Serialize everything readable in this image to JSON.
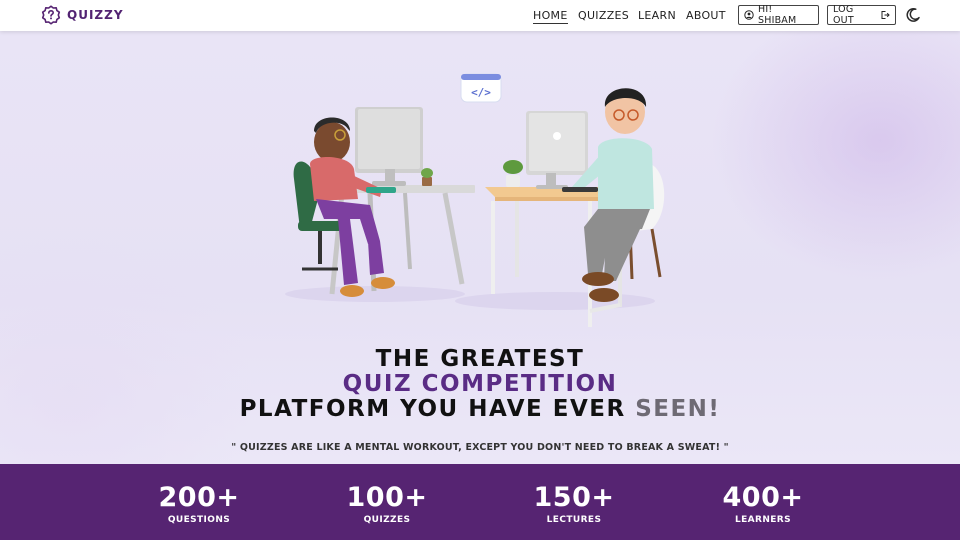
{
  "brand": {
    "name": "QUIZZY",
    "accent": "#562472"
  },
  "nav": {
    "links": [
      {
        "label": "HOME",
        "active": true
      },
      {
        "label": "QUIZZES",
        "active": false
      },
      {
        "label": "LEARN",
        "active": false
      },
      {
        "label": "ABOUT",
        "active": false
      }
    ],
    "user_button": "HI! SHIBAM",
    "logout_button": "LOG OUT",
    "theme_toggle_icon": "moon-icon"
  },
  "hero": {
    "title_line1": "THE GREATEST",
    "title_line2": "QUIZ COMPETITION",
    "title_line3_main": "PLATFORM YOU HAVE EVER",
    "title_line3_accent": "SEEN!",
    "quote": "\" QUIZZES ARE LIKE A MENTAL WORKOUT, EXCEPT YOU DON'T NEED TO BREAK A SWEAT! \"",
    "code_badge": "</>"
  },
  "stats": [
    {
      "value": "200+",
      "label": "QUESTIONS"
    },
    {
      "value": "100+",
      "label": "QUIZZES"
    },
    {
      "value": "150+",
      "label": "LECTURES"
    },
    {
      "value": "400+",
      "label": "LEARNERS"
    }
  ]
}
